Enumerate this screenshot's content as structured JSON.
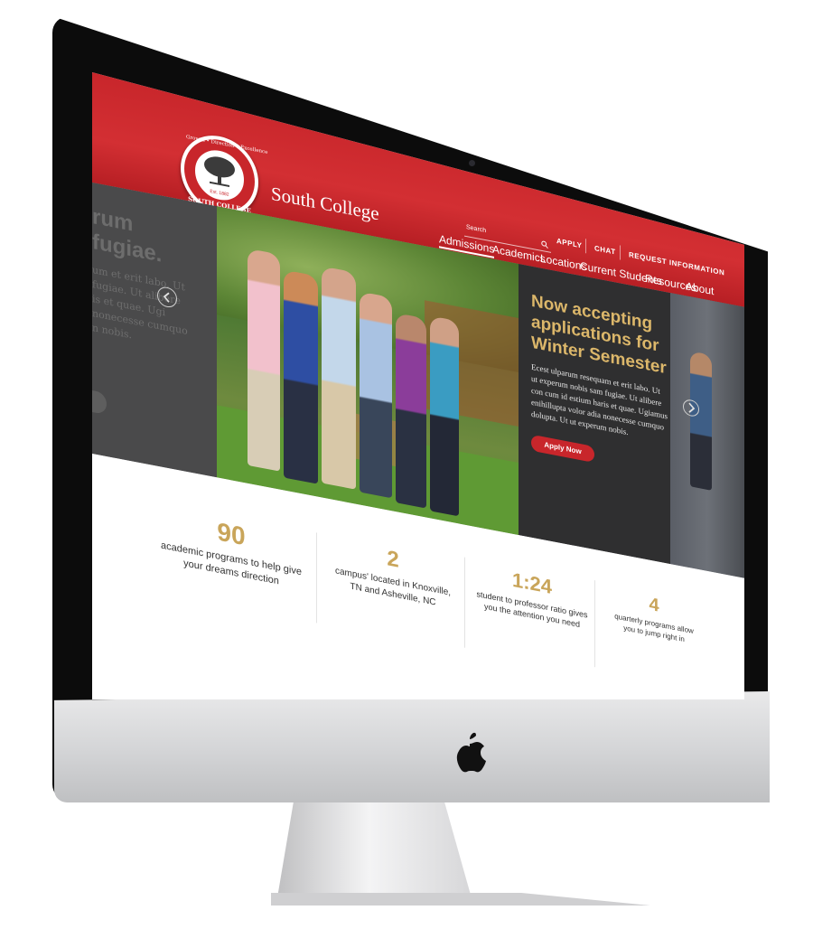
{
  "site": {
    "name": "South College",
    "seal_text_top": "Growth • Direction • Excellence",
    "seal_text_bottom": "SOUTH COLLEGE",
    "seal_year": "Est. 1882"
  },
  "utility_nav": {
    "search_placeholder": "Search",
    "apply": "APPLY",
    "chat": "CHAT",
    "request_info": "REQUEST INFORMATION"
  },
  "main_nav": [
    {
      "label": "Admissions",
      "active": true
    },
    {
      "label": "Academics"
    },
    {
      "label": "Locations"
    },
    {
      "label": "Current Students"
    },
    {
      "label": "Resources"
    },
    {
      "label": "About"
    }
  ],
  "hero": {
    "ghost_heading_1": "rum",
    "ghost_heading_2": "fugiae.",
    "ghost_text_1": "um et erit labo. Ut",
    "ghost_text_2": "fugiae. Ut alibere",
    "ghost_text_3": "is et quae. Ugi",
    "ghost_text_4": "nonecesse cumquo",
    "ghost_text_5": "n nobis.",
    "heading": "Now accepting applications for Winter Semester",
    "heading_line_1": "Now accepting",
    "heading_line_2": "applications for",
    "heading_line_3": "Winter Semester",
    "body_line_1": "Ecest ulparum resequam et erit labo. Ut",
    "body_line_2": "ut experum nobis sam fugiae. Ut alibere",
    "body_line_3": "con cum id estium haris et quae. Ugiamus",
    "body_line_4": "enihillupta volor adia nonecesse cumquo",
    "body_line_5": "dolupta. Ut ut experum nobis.",
    "cta": "Apply Now",
    "prev_icon": "chevron-left",
    "next_icon": "chevron-right"
  },
  "stats": [
    {
      "number": "90",
      "line_1": "academic programs to help give",
      "line_2": "your dreams direction"
    },
    {
      "number": "2",
      "line_1": "campus' located in Knoxville,",
      "line_2": "TN and Asheville, NC"
    },
    {
      "number": "1:24",
      "line_1": "student to professor ratio gives",
      "line_2": "you the attention you need"
    },
    {
      "number": "4",
      "line_1": "quarterly programs allow",
      "line_2": "you to jump right in"
    }
  ],
  "colors": {
    "brand_red": "#c8262b",
    "gold": "#c9a55a",
    "dark": "#2f2f30"
  }
}
